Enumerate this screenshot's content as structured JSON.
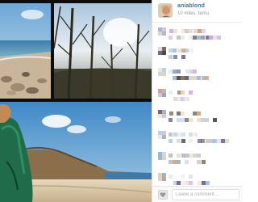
{
  "post": {
    "username": "aniablond",
    "time_ago": "10 miles. temu."
  },
  "comment_box": {
    "placeholder": "Leave a comment..."
  },
  "icons": {
    "like": "heart-icon",
    "avatar": "user-avatar"
  },
  "colors": {
    "username": "#3f729b",
    "photo_frame": "#0d0d0d",
    "sky": "#6aa8d8",
    "sea": "#2e6f9b",
    "sand": "#d9c7a6"
  },
  "comments_blurred": true
}
